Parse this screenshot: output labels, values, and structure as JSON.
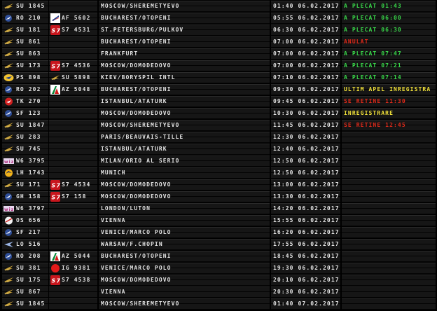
{
  "board": {
    "title": "",
    "rows": [
      {
        "airline": "SU",
        "flight": "1845",
        "logo": "aeroflot-icon",
        "codeshare_logo": "",
        "codeshare": "",
        "destination": "MOSCOW/SHEREMETYEVO",
        "time": "01:40",
        "date": "06.02.2017",
        "status": "A PLECAT 01:43",
        "status_color": "green"
      },
      {
        "airline": "RO",
        "flight": "210",
        "logo": "tarom-icon",
        "codeshare_logo": "airfrance-icon",
        "codeshare": "AF 5602",
        "destination": "BUCHAREST/OTOPENI",
        "time": "05:55",
        "date": "06.02.2017",
        "status": "A PLECAT 06:00",
        "status_color": "green"
      },
      {
        "airline": "SU",
        "flight": "181",
        "logo": "aeroflot-icon",
        "codeshare_logo": "s7-icon",
        "codeshare": "S7 4531",
        "destination": "ST.PETERSBURG/PULKOV",
        "time": "06:30",
        "date": "06.02.2017",
        "status": "A PLECAT 06:30",
        "status_color": "green"
      },
      {
        "airline": "SU",
        "flight": "861",
        "logo": "aeroflot-icon",
        "codeshare_logo": "",
        "codeshare": "",
        "destination": "BUCHAREST/OTOPENI",
        "time": "07:00",
        "date": "06.02.2017",
        "status": "ANULAT",
        "status_color": "red"
      },
      {
        "airline": "SU",
        "flight": "863",
        "logo": "aeroflot-icon",
        "codeshare_logo": "",
        "codeshare": "",
        "destination": "FRANKFURT",
        "time": "07:00",
        "date": "06.02.2017",
        "status": "A PLECAT 07:47",
        "status_color": "green"
      },
      {
        "airline": "SU",
        "flight": "173",
        "logo": "aeroflot-icon",
        "codeshare_logo": "s7-icon",
        "codeshare": "S7 4536",
        "destination": "MOSCOW/DOMODEDOVO",
        "time": "07:00",
        "date": "06.02.2017",
        "status": "A PLECAT 07:21",
        "status_color": "green"
      },
      {
        "airline": "PS",
        "flight": "898",
        "logo": "uia-icon",
        "codeshare_logo": "aeroflot-icon",
        "codeshare": "SU 5898",
        "destination": "KIEV/BORYSPIL INTL",
        "time": "07:10",
        "date": "06.02.2017",
        "status": "A PLECAT 07:14",
        "status_color": "green"
      },
      {
        "airline": "RO",
        "flight": "202",
        "logo": "tarom-icon",
        "codeshare_logo": "alitalia-icon",
        "codeshare": "AZ 5048",
        "destination": "BUCHAREST/OTOPENI",
        "time": "09:30",
        "date": "06.02.2017",
        "status": "ULTIM APEL INREGISTRA",
        "status_color": "yellow"
      },
      {
        "airline": "TK",
        "flight": "270",
        "logo": "turkish-icon",
        "codeshare_logo": "",
        "codeshare": "",
        "destination": "ISTANBUL/ATATURK",
        "time": "09:45",
        "date": "06.02.2017",
        "status": "SE RETINE 11:30",
        "status_color": "red"
      },
      {
        "airline": "SF",
        "flight": "123",
        "logo": "tarom-icon",
        "codeshare_logo": "",
        "codeshare": "",
        "destination": "MOSCOW/DOMODEDOVO",
        "time": "10:30",
        "date": "06.02.2017",
        "status": "INREGISTRARE",
        "status_color": "yellow"
      },
      {
        "airline": "SU",
        "flight": "1847",
        "logo": "aeroflot-icon",
        "codeshare_logo": "",
        "codeshare": "",
        "destination": "MOSCOW/SHEREMETYEVO",
        "time": "11:45",
        "date": "06.02.2017",
        "status": "SE RETINE 12:45",
        "status_color": "red"
      },
      {
        "airline": "SU",
        "flight": "283",
        "logo": "aeroflot-icon",
        "codeshare_logo": "",
        "codeshare": "",
        "destination": "PARIS/BEAUVAIS-TILLE",
        "time": "12:30",
        "date": "06.02.2017",
        "status": "",
        "status_color": "green"
      },
      {
        "airline": "SU",
        "flight": "745",
        "logo": "aeroflot-icon",
        "codeshare_logo": "",
        "codeshare": "",
        "destination": "ISTANBUL/ATATURK",
        "time": "12:40",
        "date": "06.02.2017",
        "status": "",
        "status_color": "green"
      },
      {
        "airline": "W6",
        "flight": "3795",
        "logo": "wizz-icon",
        "codeshare_logo": "",
        "codeshare": "",
        "destination": "MILAN/ORIO AL SERIO",
        "time": "12:50",
        "date": "06.02.2017",
        "status": "",
        "status_color": "green"
      },
      {
        "airline": "LH",
        "flight": "1743",
        "logo": "lufthansa-icon",
        "codeshare_logo": "",
        "codeshare": "",
        "destination": "MUNICH",
        "time": "12:50",
        "date": "06.02.2017",
        "status": "",
        "status_color": "green"
      },
      {
        "airline": "SU",
        "flight": "171",
        "logo": "aeroflot-icon",
        "codeshare_logo": "s7-icon",
        "codeshare": "S7 4534",
        "destination": "MOSCOW/DOMODEDOVO",
        "time": "13:00",
        "date": "06.02.2017",
        "status": "",
        "status_color": "green"
      },
      {
        "airline": "GH",
        "flight": "158",
        "logo": "tarom-icon",
        "codeshare_logo": "s7-icon",
        "codeshare": "S7 158",
        "destination": "MOSCOW/DOMODEDOVO",
        "time": "13:30",
        "date": "06.02.2017",
        "status": "",
        "status_color": "green"
      },
      {
        "airline": "W6",
        "flight": "3797",
        "logo": "wizz-icon",
        "codeshare_logo": "",
        "codeshare": "",
        "destination": "LONDON/LUTON",
        "time": "14:20",
        "date": "06.02.2017",
        "status": "",
        "status_color": "green"
      },
      {
        "airline": "OS",
        "flight": "656",
        "logo": "austrian-icon",
        "codeshare_logo": "",
        "codeshare": "",
        "destination": "VIENNA",
        "time": "15:55",
        "date": "06.02.2017",
        "status": "",
        "status_color": "green"
      },
      {
        "airline": "SF",
        "flight": "217",
        "logo": "tarom-icon",
        "codeshare_logo": "",
        "codeshare": "",
        "destination": "VENICE/MARCO POLO",
        "time": "16:20",
        "date": "06.02.2017",
        "status": "",
        "status_color": "green"
      },
      {
        "airline": "LO",
        "flight": "516",
        "logo": "lot-icon",
        "codeshare_logo": "",
        "codeshare": "",
        "destination": "WARSAW/F.CHOPIN",
        "time": "17:55",
        "date": "06.02.2017",
        "status": "",
        "status_color": "green"
      },
      {
        "airline": "RO",
        "flight": "208",
        "logo": "tarom-icon",
        "codeshare_logo": "alitalia-icon",
        "codeshare": "AZ 5044",
        "destination": "BUCHAREST/OTOPENI",
        "time": "18:45",
        "date": "06.02.2017",
        "status": "",
        "status_color": "green"
      },
      {
        "airline": "SU",
        "flight": "381",
        "logo": "aeroflot-icon",
        "codeshare_logo": "iberia-icon",
        "codeshare": "IG 9381",
        "destination": "VENICE/MARCO POLO",
        "time": "19:30",
        "date": "06.02.2017",
        "status": "",
        "status_color": "green"
      },
      {
        "airline": "SU",
        "flight": "175",
        "logo": "aeroflot-icon",
        "codeshare_logo": "s7-icon",
        "codeshare": "S7 4538",
        "destination": "MOSCOW/DOMODEDOVO",
        "time": "20:10",
        "date": "06.02.2017",
        "status": "",
        "status_color": "green"
      },
      {
        "airline": "SU",
        "flight": "867",
        "logo": "aeroflot-icon",
        "codeshare_logo": "",
        "codeshare": "",
        "destination": "VIENNA",
        "time": "20:30",
        "date": "06.02.2017",
        "status": "",
        "status_color": "green"
      },
      {
        "airline": "SU",
        "flight": "1845",
        "logo": "aeroflot-icon",
        "codeshare_logo": "",
        "codeshare": "",
        "destination": "MOSCOW/SHEREMETYEVO",
        "time": "01:40",
        "date": "07.02.2017",
        "status": "",
        "status_color": "green"
      }
    ]
  },
  "colors": {
    "green": "#39d84a",
    "red": "#e02a1a",
    "yellow": "#f2e23a",
    "text": "#e4e4e4",
    "cell_bg": "#161616"
  }
}
